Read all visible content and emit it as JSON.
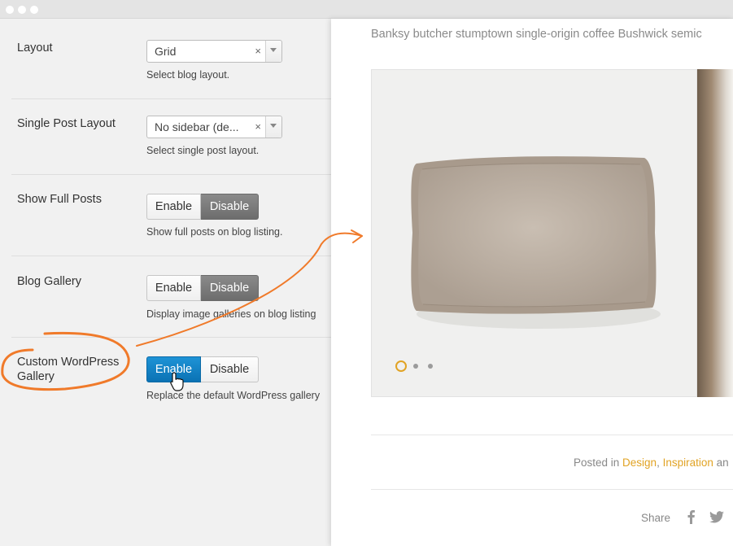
{
  "settings": {
    "layout": {
      "label": "Layout",
      "value": "Grid",
      "clear": "×",
      "desc": "Select blog layout."
    },
    "single_post_layout": {
      "label": "Single Post Layout",
      "value": "No sidebar (de...",
      "clear": "×",
      "desc": "Select single post layout."
    },
    "show_full_posts": {
      "label": "Show Full Posts",
      "enable": "Enable",
      "disable": "Disable",
      "desc": "Show full posts on blog listing."
    },
    "blog_gallery": {
      "label": "Blog Gallery",
      "enable": "Enable",
      "disable": "Disable",
      "desc": "Display image galleries on blog listing"
    },
    "custom_gallery": {
      "label_line1": "Custom WordPress",
      "label_line2": "Gallery",
      "enable": "Enable",
      "disable": "Disable",
      "desc": "Replace the default WordPress gallery"
    }
  },
  "preview": {
    "intro": "Banksy butcher stumptown single-origin coffee Bushwick semic",
    "posted_prefix": "Posted in ",
    "category1": "Design",
    "comma": ", ",
    "category2": "Inspiration",
    "posted_suffix": " an",
    "share_label": "Share",
    "share_icons": [
      "facebook-icon",
      "twitter-icon"
    ]
  },
  "colors": {
    "accent_blue": "#0f7fc6",
    "annotation_orange": "#f07a2a",
    "link_gold": "#e1a324",
    "active_dark": "#777777"
  }
}
